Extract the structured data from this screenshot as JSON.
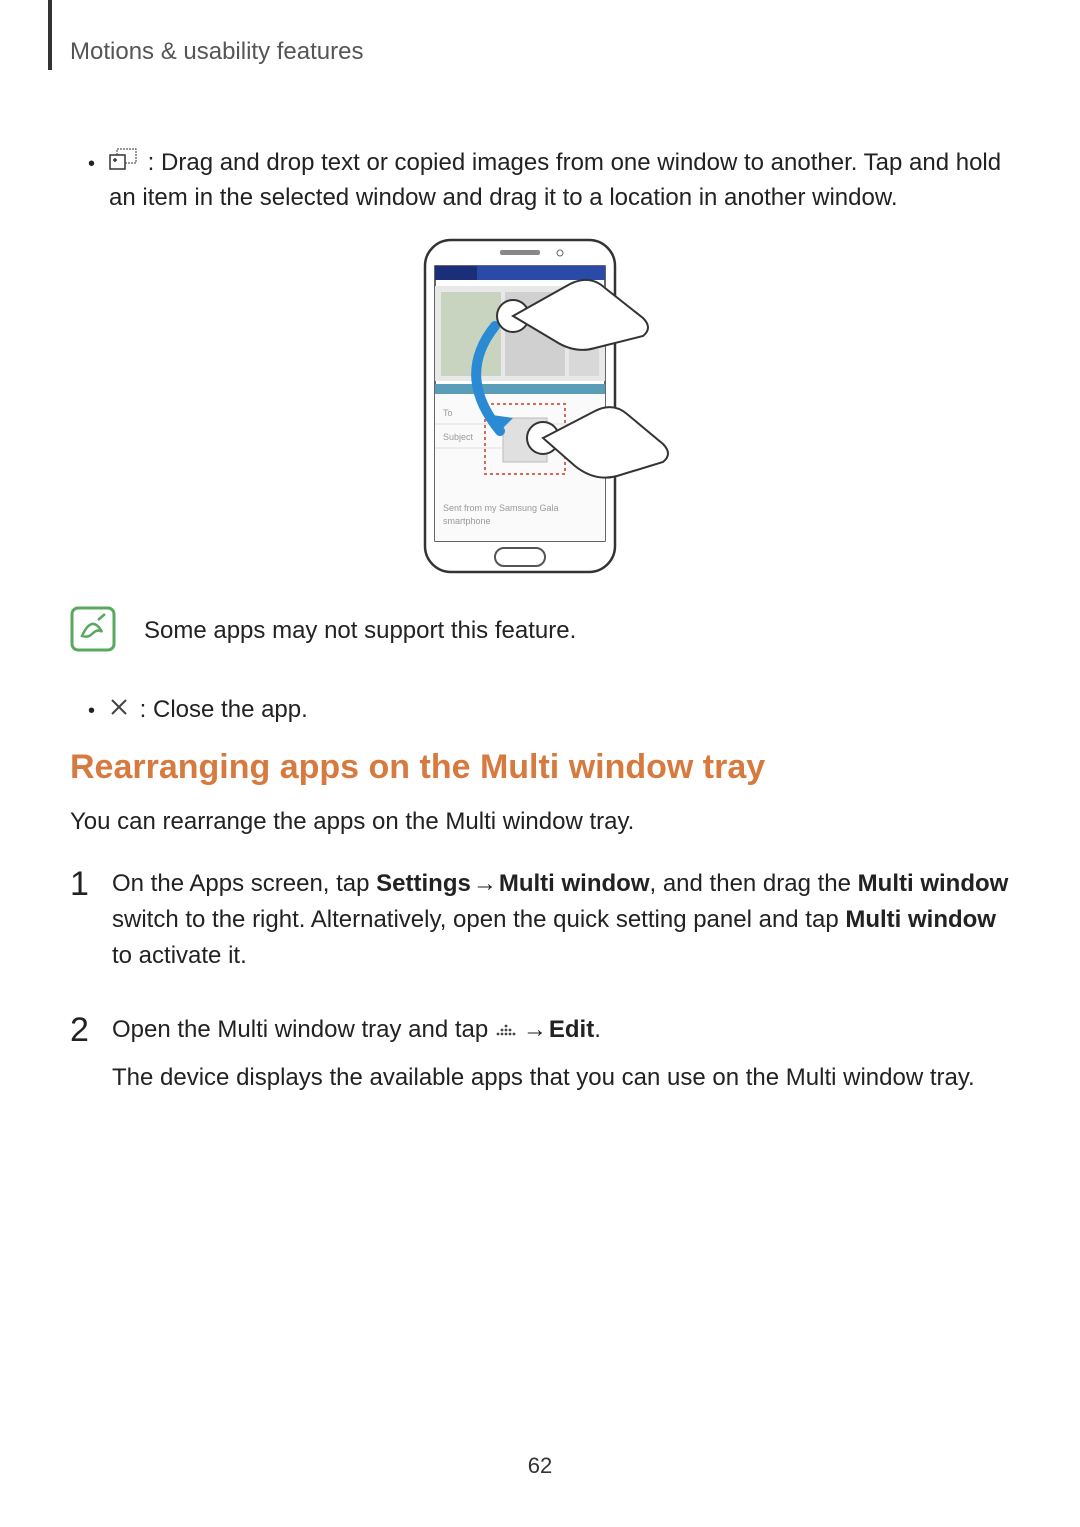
{
  "header": {
    "breadcrumb": "Motions & usability features"
  },
  "bullets": {
    "drag_drop": " : Drag and drop text or copied images from one window to another. Tap and hold an item in the selected window and drag it to a location in another window.",
    "close_app": " : Close the app."
  },
  "note": {
    "text": "Some apps may not support this feature."
  },
  "section": {
    "heading": "Rearranging apps on the Multi window tray",
    "intro": "You can rearrange the apps on the Multi window tray."
  },
  "steps": {
    "s1": {
      "num": "1",
      "t1": "On the Apps screen, tap ",
      "b1": "Settings",
      "arrow1": " → ",
      "b2": "Multi window",
      "t2": ", and then drag the ",
      "b3": "Multi window",
      "t3": " switch to the right. Alternatively, open the quick setting panel and tap ",
      "b4": "Multi window",
      "t4": " to activate it."
    },
    "s2": {
      "num": "2",
      "t1": "Open the Multi window tray and tap ",
      "arrow1": " → ",
      "b1": "Edit",
      "t2": ".",
      "p2": "The device displays the available apps that you can use on the Multi window tray."
    }
  },
  "page_number": "62"
}
